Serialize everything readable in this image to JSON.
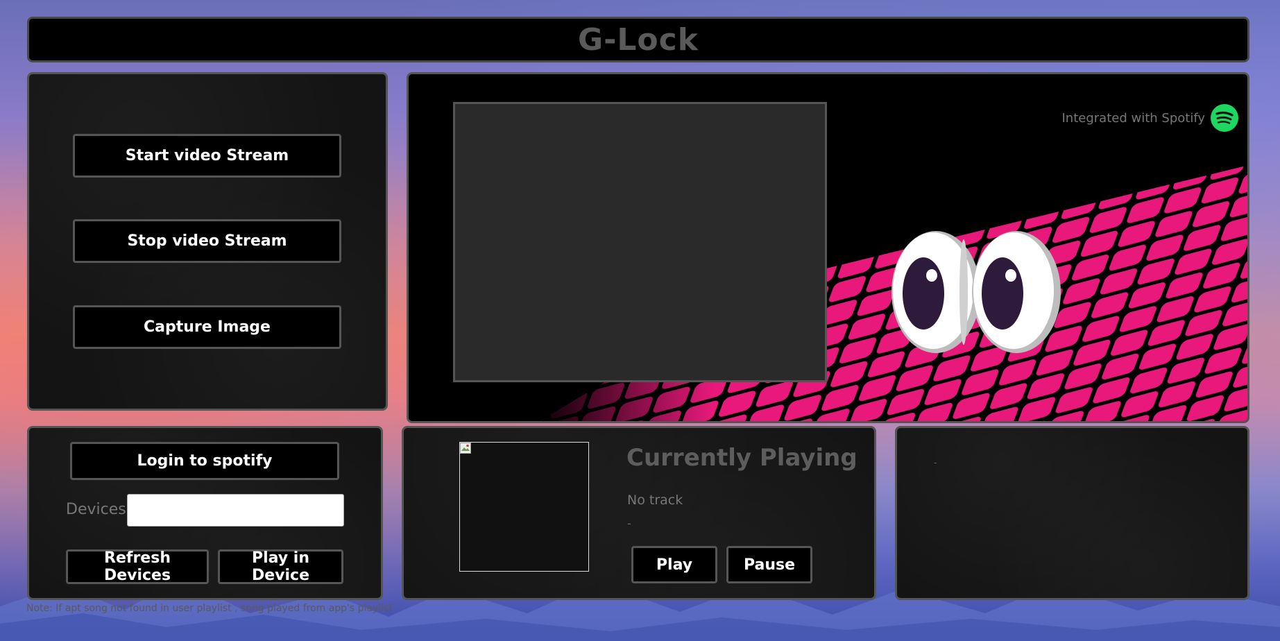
{
  "header": {
    "title": "G-Lock"
  },
  "stream_controls": {
    "start_label": "Start video Stream",
    "stop_label": "Stop video Stream",
    "capture_label": "Capture Image"
  },
  "preview": {
    "spotify_note": "Integrated with Spotify",
    "spotify_icon": "spotify-logo-icon",
    "accent_colors": {
      "tile_pink": "#e8197a",
      "spotify_green": "#1ed760"
    }
  },
  "spotify_panel": {
    "login_label": "Login to spotify",
    "devices_label": "Devices",
    "devices_value": "",
    "refresh_label": "Refresh Devices",
    "play_in_device_label": "Play in Device"
  },
  "now_playing": {
    "heading": "Currently Playing",
    "track": "No track",
    "artist": "-",
    "play_label": "Play",
    "pause_label": "Pause"
  },
  "side_panel": {
    "text": "-"
  },
  "footnote": "Note: If apt song not found in user playlist , song played from app's playlist."
}
